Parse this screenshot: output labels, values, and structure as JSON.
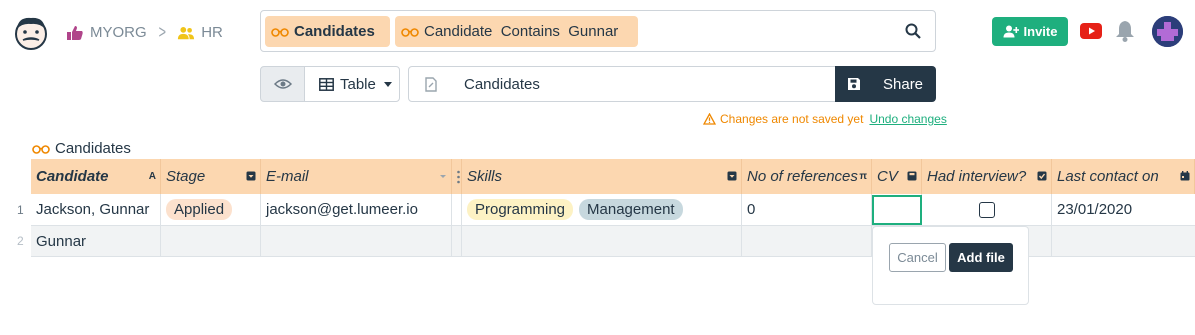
{
  "header": {
    "logo": "lumeer-logo-icon",
    "breadcrumb": {
      "org": "MYORG",
      "project": "HR",
      "separator": ">"
    },
    "search": {
      "chips": [
        "Candidates",
        "Candidate  Contains  Gunnar"
      ]
    },
    "invite_label": "Invite",
    "colors": {
      "invite": "#1eaf7e",
      "chip": "#fcd7b0",
      "dark": "#253746"
    }
  },
  "toolbar": {
    "perspective_label": "Table",
    "view_name": "Candidates",
    "share_label": "Share",
    "unsaved_text": "Changes are not saved yet",
    "undo_label": "Undo changes"
  },
  "table": {
    "title": "Candidates",
    "columns": [
      {
        "label": "Candidate",
        "icon": "A"
      },
      {
        "label": "Stage",
        "icon": "dropdown-icon"
      },
      {
        "label": "E-mail",
        "icon": "sort-icon"
      },
      {
        "label": "Skills",
        "icon": "dropdown-icon"
      },
      {
        "label": "No of references",
        "icon": "π"
      },
      {
        "label": "CV",
        "icon": "file-icon"
      },
      {
        "label": "Had interview?",
        "icon": "checkbox-icon"
      },
      {
        "label": "Last contact on",
        "icon": "calendar-icon"
      }
    ],
    "rows": [
      {
        "num": "1",
        "candidate": "Jackson, Gunnar",
        "stage": "Applied",
        "email": "jackson@get.lumeer.io",
        "skills": [
          "Programming",
          "Management"
        ],
        "references": "0",
        "cv": "",
        "interview": false,
        "last_contact": "23/01/2020"
      },
      {
        "num": "2",
        "candidate": "Gunnar"
      }
    ]
  },
  "cv_popover": {
    "cancel_label": "Cancel",
    "add_label": "Add file"
  }
}
